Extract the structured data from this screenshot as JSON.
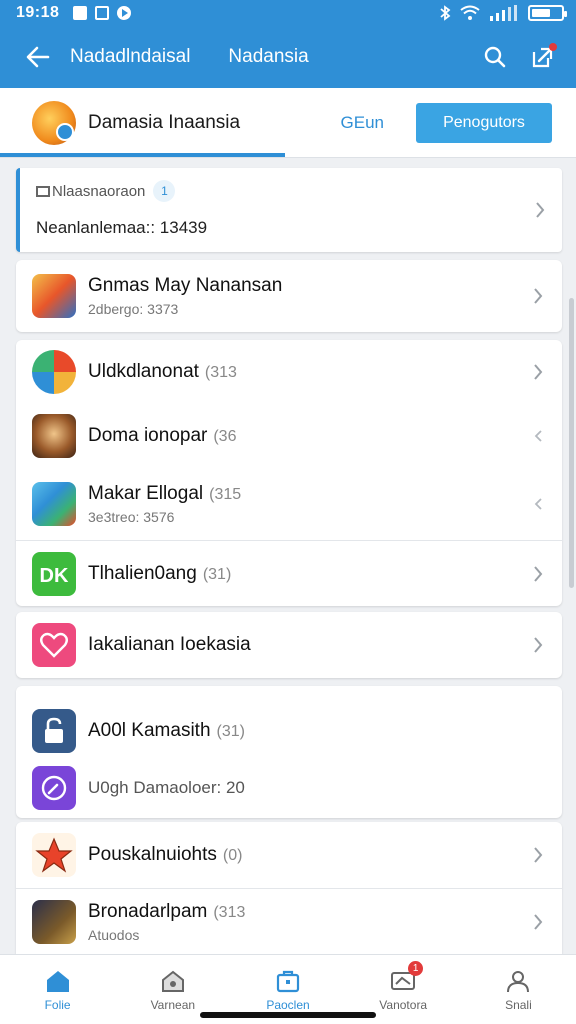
{
  "status_bar": {
    "time": "19:18",
    "battery_level": 0.65
  },
  "app_bar": {
    "title_left": "Nadadlndaisal",
    "title_center": "Nadansia"
  },
  "header": {
    "account_name": "Damasia Inaansia",
    "link_label": "GEun",
    "button_label": "Penogutors"
  },
  "highlight_card": {
    "title": "Nlaasnaoraon",
    "badge": "1",
    "subtitle": "Neanlanlemaa:: 13439"
  },
  "featured": {
    "title": "Gnmas May Nanansan",
    "subtitle": "2dbergo: 3373"
  },
  "group1": [
    {
      "title": "Uldkdlanonat",
      "count": "(313",
      "subtitle": ""
    },
    {
      "title": "Doma ionopar",
      "count": "(36",
      "subtitle": ""
    },
    {
      "title": "Makar Ellogal",
      "count": "(315",
      "subtitle": "3e3treo: 3576"
    },
    {
      "title": "Tlhalien0ang",
      "count": "(31)",
      "subtitle": ""
    }
  ],
  "single_item": {
    "title": "Iakalianan Ioekasia"
  },
  "group2": [
    {
      "title": "A00l Kamasith",
      "count": "(31)"
    },
    {
      "title": "U0gh Damaoloer: 20",
      "count": ""
    }
  ],
  "group3": [
    {
      "title": "Pouskalnuiohts",
      "count": "(0)",
      "subtitle": ""
    },
    {
      "title": "Bronadarlpam",
      "count": "(313",
      "subtitle": "Atuodos"
    }
  ],
  "bottom_nav": [
    {
      "label": "Folie",
      "icon": "home-icon"
    },
    {
      "label": "Varnean",
      "icon": "house-outline-icon"
    },
    {
      "label": "Paoclen",
      "icon": "briefcase-icon"
    },
    {
      "label": "Vanotora",
      "icon": "message-icon",
      "badge": "1"
    },
    {
      "label": "Snali",
      "icon": "user-icon"
    }
  ],
  "colors": {
    "primary": "#2f8fd6",
    "accent_button": "#3aa4e3",
    "badge": "#e23b3b"
  }
}
